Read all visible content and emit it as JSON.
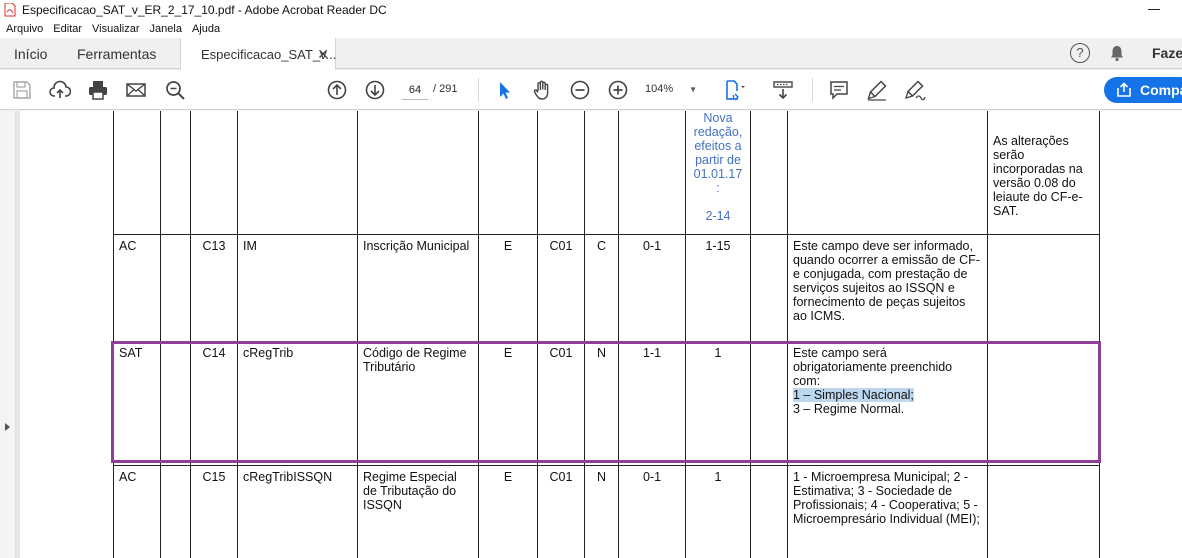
{
  "window": {
    "title": "Especificacao_SAT_v_ER_2_17_10.pdf - Adobe Acrobat Reader DC"
  },
  "menu": [
    "Arquivo",
    "Editar",
    "Visualizar",
    "Janela",
    "Ajuda"
  ],
  "tabs": {
    "home": "Início",
    "tools": "Ferramentas",
    "doc": "Especificacao_SAT_v..."
  },
  "header_right": {
    "signin": "Faze"
  },
  "toolbar": {
    "page_current": "64",
    "page_total": "/ 291",
    "zoom": "104%",
    "share": "Compa"
  },
  "table": {
    "row0": {
      "note_lines": [
        "Nova",
        "redação,",
        "efeitos a",
        "partir de",
        "01.01.17",
        ":"
      ],
      "note_ref": "2-14",
      "remark": "As alterações serão incorporadas na versão 0.08 do leiaute do CF-e-SAT."
    },
    "row1": {
      "origin": "AC",
      "id": "C13",
      "field": "IM",
      "desc": "Inscrição Municipal",
      "elem": "E",
      "parent": "C01",
      "type": "C",
      "occ": "0-1",
      "size": "1-15",
      "obs": "Este campo deve ser informado, quando ocorrer a emissão de CF-e conjugada, com prestação de serviços sujeitos ao ISSQN e fornecimento de peças sujeitos ao ICMS."
    },
    "row2": {
      "origin": "SAT",
      "id": "C14",
      "field": "cRegTrib",
      "desc": "Código de Regime Tributário",
      "elem": "E",
      "parent": "C01",
      "type": "N",
      "occ": "1-1",
      "size": "1",
      "obs_intro": "Este campo será obrigatoriamente preenchido com:",
      "obs_opt1": "1 – Simples Nacional;",
      "obs_opt2": "3 – Regime Normal."
    },
    "row3": {
      "origin": "AC",
      "id": "C15",
      "field": "cRegTribISSQN",
      "desc": "Regime Especial de Tributação do ISSQN",
      "elem": "E",
      "parent": "C01",
      "type": "N",
      "occ": "0-1",
      "size": "1",
      "obs": "1 - Microempresa Municipal; 2 - Estimativa; 3 - Sociedade de Profissionais; 4 - Cooperativa; 5 - Microempresário Individual (MEI);"
    }
  },
  "colors": {
    "accent": "#1473e6",
    "highlight_border": "#8e3f97",
    "selection": "#bdd7ee",
    "note_text": "#4472c4"
  }
}
